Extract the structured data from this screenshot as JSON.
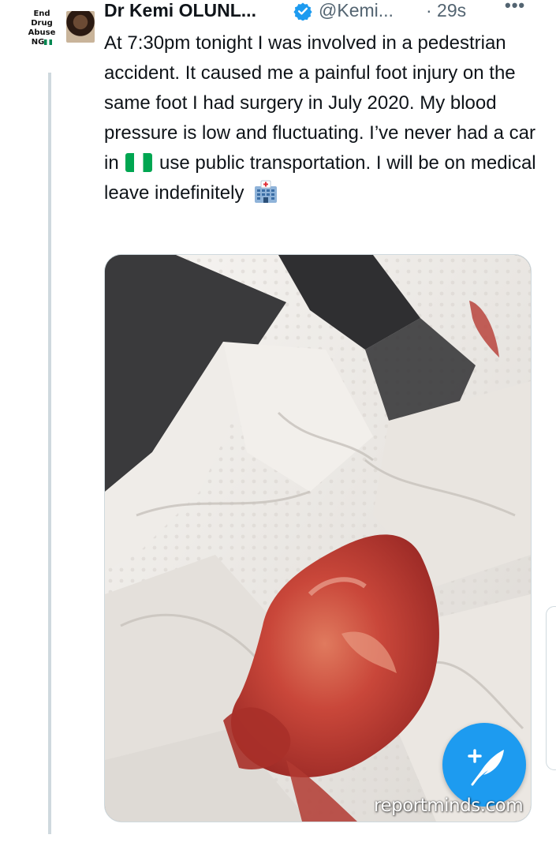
{
  "avatar": {
    "lines": [
      "End",
      "Drug",
      "Abuse",
      "NG"
    ],
    "flag_icon": "nigeria-flag-icon"
  },
  "tweet": {
    "author_name": "Dr Kemi OLUNL...",
    "handle": "@Kemi...",
    "time": "· 29s",
    "more_icon": "more-icon",
    "more_label": "•••",
    "text_parts": [
      "At 7:30pm tonight I was involved in a pedestrian accident. It caused me a painful foot injury on the same foot I had surgery in July 2020. My blood pressure is low and fluctuating. I’ve never had a car in",
      "use public transportation. I will be on medical leave indefinitely"
    ],
    "emoji": [
      "nigeria-flag-icon",
      "hospital-icon"
    ]
  },
  "compose_button": {
    "icon": "compose-feather-icon",
    "label": "+"
  },
  "watermark": "reportminds.com",
  "colors": {
    "accent": "#1d9bf0",
    "text": "#0f1419",
    "secondary": "#536471",
    "border": "#cfd9de"
  }
}
